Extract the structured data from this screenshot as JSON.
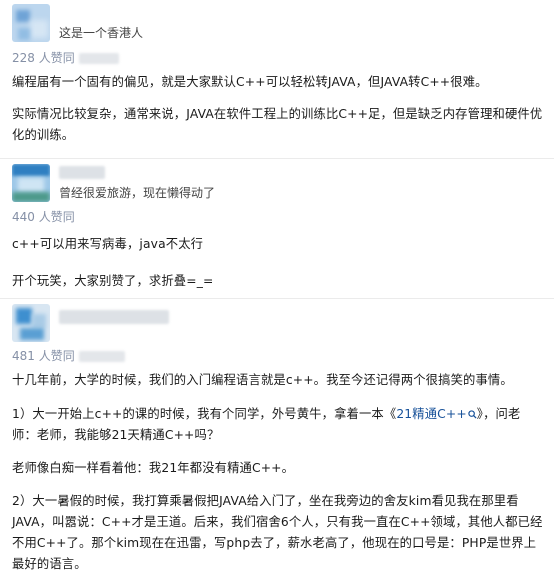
{
  "answers": [
    {
      "bio": "这是一个香港人",
      "votes": "228 人赞同",
      "paragraphs": [
        "编程届有一个固有的偏见，就是大家默认C++可以轻松转JAVA，但JAVA转C++很难。",
        "实际情况比较复杂，通常来说，JAVA在软件工程上的训练比C++足，但是缺乏内存管理和硬件优化的训练。"
      ]
    },
    {
      "bio": "曾经很爱旅游，现在懒得动了",
      "votes": "440 人赞同",
      "paragraphs": [
        "c++可以用来写病毒，java不太行",
        "开个玩笑，大家别赞了，求折叠=_="
      ]
    },
    {
      "bio": "",
      "votes": "481 人赞同",
      "paragraphs": [
        "十几年前，大学的时候，我们的入门编程语言就是c++。我至今还记得两个很搞笑的事情。",
        "老师像白痴一样看着他：我21年都没有精通C++。",
        "2）大一暑假的时候，我打算乘暑假把JAVA给入门了，坐在我旁边的舍友kim看见我在那里看JAVA，叫嚣说：C++才是王道。后来，我们宿舍6个人，只有我一直在C++领域，其他人都已经不用C++了。那个kim现在在迅雷，写php去了，薪水老高了，他现在的口号是：PHP是世界上最好的语言。"
      ],
      "p1_before": "1）大一开始上c++的课的时候，我有个同学，外号黄牛，拿着一本《",
      "p1_link": "21精通C++",
      "p1_after": "》，问老师：老师，我能够21天精通C++吗？"
    }
  ],
  "colors": {
    "link": "#175199",
    "meta": "#8590a6",
    "text": "#1a1a1a"
  }
}
